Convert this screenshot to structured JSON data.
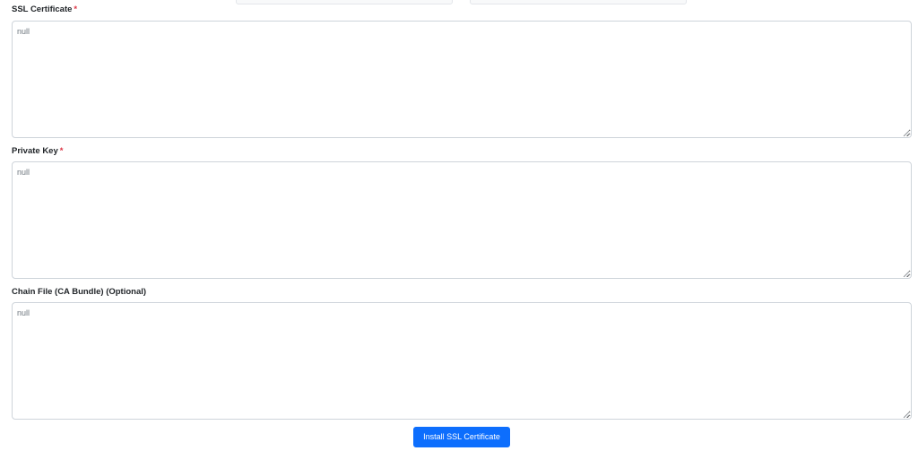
{
  "form": {
    "ssl_certificate": {
      "label": "SSL Certificate",
      "required_marker": "*",
      "value": "null"
    },
    "private_key": {
      "label": "Private Key",
      "required_marker": "*",
      "value": "null"
    },
    "chain_file": {
      "label": "Chain File (CA Bundle) (Optional)",
      "value": "null"
    },
    "submit_label": "Install SSL Certificate"
  },
  "colors": {
    "primary_button": "#0d6efd",
    "required_marker": "#dc3545",
    "border": "#ced4da"
  }
}
